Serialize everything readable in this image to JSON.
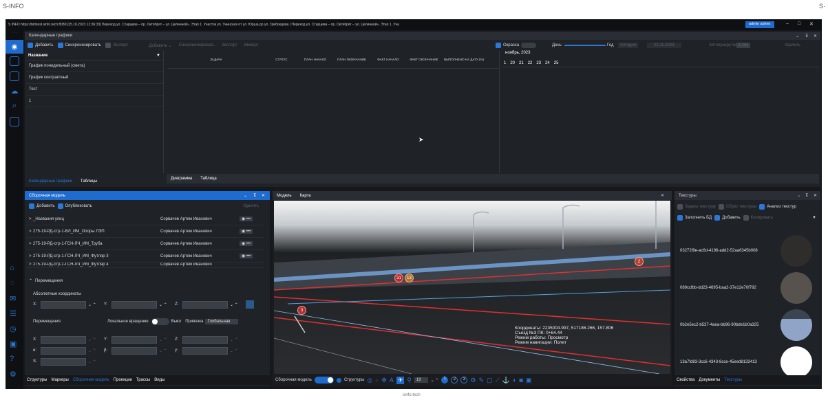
{
  "outer": {
    "brand_left": "S-INFO",
    "brand_right": "S·",
    "footer": "sinfo.tech"
  },
  "window": {
    "title": "S INFO   https://bimtest.sinfo.tech:8080   [25.10.2023 12:36:33] Переход ул. Старцева – пр. Октябрят – ул. Целинной». Этап 1. Участок ул. Унинская от ул. Юрша до ул. Грибоедова | Переход ул. Старцева – пр. Октябрят – ул. Целинной». Этап 1. Уча",
    "user": "admin admin",
    "controls": [
      "–",
      "□",
      "✕"
    ]
  },
  "calendar_panel": {
    "title": "Календарные графики",
    "header_controls": [
      "⌄",
      "⊼",
      "✕"
    ],
    "toolbar_left": {
      "add": "Добавить",
      "sync": "Синхронизировать",
      "export": "Экспорт"
    },
    "toolbar_right": {
      "add": "Добавить ⌄",
      "sync": "Синхронизировать",
      "export": "Экспорт",
      "import": "Импорт"
    },
    "right_controls": {
      "coloring": "Окраска",
      "day": "День",
      "year": "Год",
      "today": "Сегодня",
      "date": "22.11.2023",
      "autoscroll": "Автопрокрутка",
      "autoscroll_val": "1 сек",
      "delete": "Удалить"
    },
    "list_header": "Название",
    "list_items": [
      "График понедельный (смета)",
      "График контрактный",
      "Тест",
      "1"
    ],
    "columns": [
      "ЗАДАЧА",
      "СТАТУС",
      "ПЛАН НАЧАЛО",
      "ПЛАН ОКОНЧАНИЕ",
      "ФАКТ НАЧАЛО",
      "ФАКТ ОКОНЧАНИЕ",
      "ВЫПОЛНЕНО НА ДАТУ (%)"
    ],
    "month": "ноябрь, 2023",
    "days": [
      "1",
      "20",
      "21",
      "22",
      "23",
      "24",
      "25"
    ],
    "bottom_tabs": [
      "Диаграмма",
      "Таблица"
    ],
    "outer_tabs": [
      "Календарные графики",
      "Таблицы"
    ]
  },
  "assembly_panel": {
    "title": "Сборочная модель",
    "toolbar": {
      "add": "Добавить",
      "publish": "Опубликовать",
      "delete": "Удалить"
    },
    "rows": [
      {
        "name": "_Названия улиц",
        "owner": "Сорвачев Артем Иванович"
      },
      {
        "name": "275-19-РД-стр-1-ВЛ_ИМ_Опоры ЛЭП",
        "owner": "Сорвачев Артем Иванович"
      },
      {
        "name": "275-19-РД-стр-1-ГСН-ЛЧ_ИМ_Труба",
        "owner": "Сорвачев Артем Иванович"
      },
      {
        "name": "275-19-РД-стр-1-ГСН-ЛЧ_ИМ_Футляр 3",
        "owner": "Сорвачев Артем Иванович"
      },
      {
        "name": "275-19-РД-стр-1-ГСН-ЛЧ_ИМ_Футляр 4",
        "owner": "Сорвачев Артем Иванович"
      }
    ],
    "move_section": "Перемещения",
    "abs_coords": "Абсолютные координаты",
    "axis": {
      "x": "X:",
      "y": "Y:",
      "z": "Z:",
      "alpha": "α:",
      "beta": "β:",
      "gamma": "γ:",
      "s": "S:"
    },
    "moves_label": "Перемещения",
    "local_rotation": "Локальное вращение",
    "off": "Выкл",
    "binding": "Привязка",
    "binding_val": "Глобальная",
    "bottom_tabs": [
      "Структуры",
      "Маркеры",
      "Сборочная модель",
      "Проекции",
      "Трассы",
      "Виды"
    ]
  },
  "viewport": {
    "tabs": [
      "Модель",
      "Карта"
    ],
    "markers": [
      "2",
      "31",
      "13",
      "3"
    ],
    "info": [
      "Координаты:  2235004.997, 517186.266, 157.806",
      "Съезд №3 ПК:  0+64.44",
      "Режим работы: Просмотр",
      "Режим навигации: Полет"
    ],
    "toolbar": {
      "assembly": "Сборочная модель",
      "structures": "Структуры",
      "level": "10",
      "pages": [
        "1",
        "2",
        "3"
      ]
    }
  },
  "textures_panel": {
    "title": "Текстуры",
    "toolbar1": {
      "set": "Задать текстуру",
      "reset": "Сброс текстуры",
      "analyze": "Анализ текстур"
    },
    "toolbar2": {
      "fill": "Заполнить БД",
      "add": "Добавить",
      "copy": "Копировать"
    },
    "items": [
      {
        "id": "03272f8e-ac6d-4196-add2-52aa6345b008",
        "color": "#2f2d2c"
      },
      {
        "id": "089ccfbb-dd23-4695-baa2-37e12e70f792",
        "color": "#57524d"
      },
      {
        "id": "0b2e5ec2-b537-4aea-bb96-90bde1b0a325",
        "color": "#8fa4c6"
      },
      {
        "id": "13a7fd83-3cc6-4343-8cce-45eed8133413",
        "color": "#ffffff"
      }
    ],
    "bottom_tabs": [
      "Свойства",
      "Документы",
      "Текстуры"
    ]
  },
  "colors": {
    "accent": "#1e6ccf",
    "panel": "#1f2227",
    "header": "#2a2e34"
  }
}
